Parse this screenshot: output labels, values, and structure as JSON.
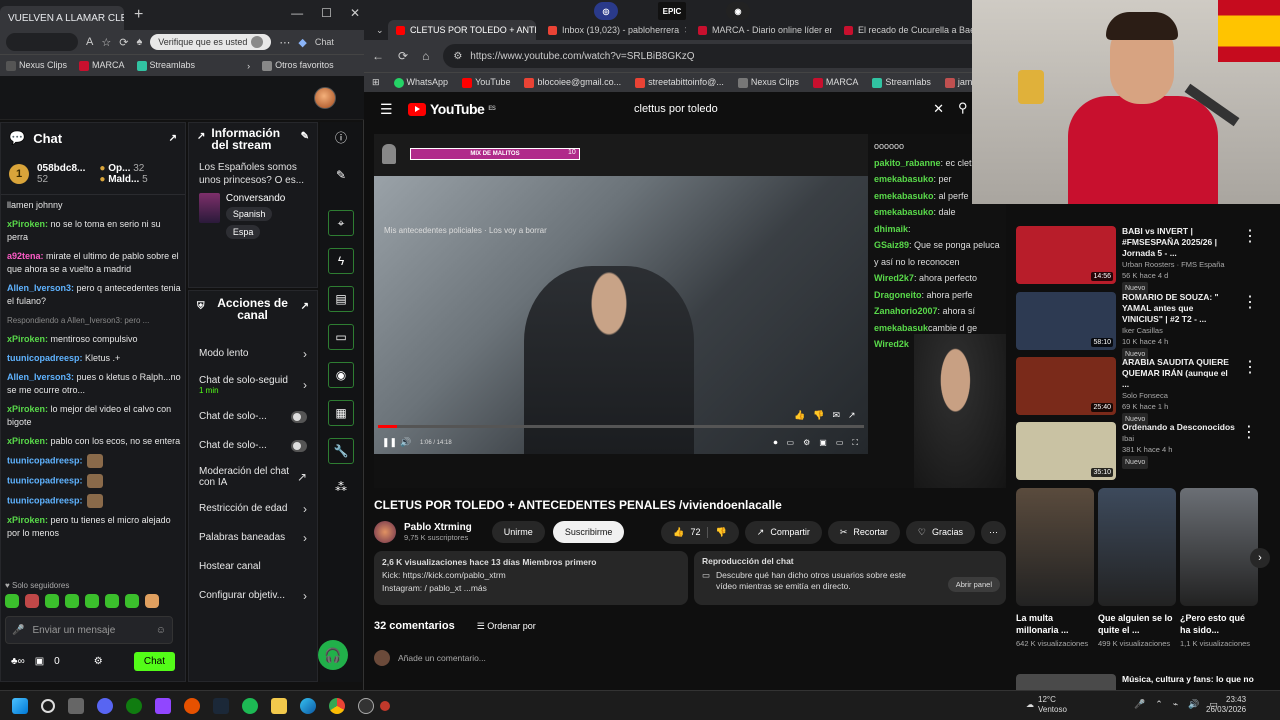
{
  "left_browser": {
    "tab_title": "VUELVEN A LLAMAR CLETUS A",
    "pill_text": "Verifique que es usted",
    "chat_label": "Chat",
    "bookmarks": [
      "Nexus Clips",
      "MARCA",
      "Streamlabs",
      "Otros favoritos"
    ]
  },
  "chat": {
    "title": "Chat",
    "leaders": [
      {
        "rank": "1",
        "name": "058bdc8...",
        "value": "52"
      },
      {
        "name": "Op...",
        "value": "32"
      },
      {
        "name": "Mald...",
        "value": "5"
      }
    ],
    "messages": [
      {
        "user": "",
        "text": "llamen johnny",
        "color": "#ffffff"
      },
      {
        "user": "xPiroken:",
        "text": "no se lo toma en serio ni su perra",
        "color": "#59d94a"
      },
      {
        "user": "a92tena:",
        "text": "mirate el ultimo de pablo sobre el que ahora se a vuelto a madrid",
        "color": "#ff5cc8"
      },
      {
        "user": "Allen_Iverson3:",
        "text": "pero q antecedentes tenia el fulano?",
        "color": "#5fb3ff"
      },
      {
        "reply": "Respondiendo a Allen_Iverson3: pero ..."
      },
      {
        "user": "xPiroken:",
        "text": "mentiroso compulsivo",
        "color": "#59d94a"
      },
      {
        "user": "tuunicopadreesp:",
        "text": "Kletus .+",
        "color": "#5fb3ff"
      },
      {
        "user": "Allen_Iverson3:",
        "text": "pues o kletus o Ralph...no se me ocurre otro...",
        "color": "#5fb3ff"
      },
      {
        "user": "xPiroken:",
        "text": "lo mejor del video el calvo con bigote",
        "color": "#59d94a"
      },
      {
        "user": "xPiroken:",
        "text": "pablo con los ecos, no se entera",
        "color": "#59d94a"
      },
      {
        "user": "tuunicopadreesp:",
        "text": "",
        "color": "#5fb3ff",
        "emote": true
      },
      {
        "user": "tuunicopadreesp:",
        "text": "",
        "color": "#5fb3ff",
        "emote": true
      },
      {
        "user": "tuunicopadreesp:",
        "text": "",
        "color": "#5fb3ff",
        "emote": true
      },
      {
        "user": "xPiroken:",
        "text": "pero tu tienes el micro alejado por lo menos",
        "color": "#59d94a"
      }
    ],
    "followers_only": "Solo seguidores",
    "input_placeholder": "Enviar un mensaje",
    "count": "0",
    "send": "Chat"
  },
  "stream_info": {
    "title": "Información del stream",
    "stream_title": "Los Españoles somos unos princesos? O es...",
    "category": "Conversando",
    "tags": [
      "Spanish",
      "Espa"
    ]
  },
  "actions": {
    "title": "Acciones de canal",
    "items": [
      {
        "label": "Modo lento",
        "kind": "chevron"
      },
      {
        "label": "Chat de solo-seguid",
        "sub": "1 min",
        "kind": "chevron"
      },
      {
        "label": "Chat de solo-...",
        "kind": "toggle"
      },
      {
        "label": "Chat de solo-...",
        "kind": "toggle"
      },
      {
        "label": "Moderación del chat con IA",
        "kind": "external"
      },
      {
        "label": "Restricción de edad",
        "kind": "chevron"
      },
      {
        "label": "Palabras baneadas",
        "kind": "chevron"
      },
      {
        "label": "Hostear canal",
        "kind": "none"
      },
      {
        "label": "Configurar objetiv...",
        "kind": "chevron"
      }
    ]
  },
  "yt_browser": {
    "tabs": [
      "CLETUS POR TOLEDO + ANTECE",
      "Inbox (19,023) - pabloherrera",
      "MARCA - Diario online líder en",
      "El recado de Cucurella a Baena"
    ],
    "top_icons": [
      "EPIC"
    ],
    "url": "https://www.youtube.com/watch?v=SRLBiB8GKzQ",
    "bookmarks": [
      "WhatsApp",
      "YouTube",
      "blocoiee@gmail.co...",
      "streetabittoinfo@...",
      "Nexus Clips",
      "MARCA",
      "Streamlabs",
      "jamonak"
    ],
    "search": "clettus por toledo",
    "logo_region": "ES"
  },
  "video": {
    "mix_bar": "MIX DE MALITOS",
    "mix_num": "10",
    "subtitle": "Mis antecedentes policiales · Los voy a borrar",
    "time": "1:06 / 14:18",
    "progress": 0.04,
    "stream_chat": [
      {
        "user": "",
        "text": "oooooo"
      },
      {
        "user": "pakito_rabanne",
        "text": ": ec cletus no?"
      },
      {
        "user": "emekabasuko",
        "text": ": per"
      },
      {
        "user": "emekabasuko",
        "text": ": al perfe"
      },
      {
        "user": "emekabasuko",
        "text": ": dale"
      },
      {
        "user": "dhimaik",
        "text": ":"
      },
      {
        "user": "GSaiz89",
        "text": ": Que se ponga peluca y así no lo reconocen"
      },
      {
        "user": "Wired2k7",
        "text": ": ahora perfecto"
      },
      {
        "user": "Dragoneito",
        "text": ": ahora perfe"
      },
      {
        "user": "Zanahorio2007",
        "text": ": ahora sí"
      },
      {
        "user": "emekabasuk",
        "text": "cambie d ge"
      },
      {
        "user": "Wired2k",
        "text": ""
      }
    ]
  },
  "meta": {
    "title": "CLETUS POR TOLEDO + ANTECEDENTES PENALES /viviendoenlacalle",
    "channel": "Pablo Xtrming",
    "subs": "9,75 K suscriptores",
    "unsubscribe": "Unirme",
    "subscribe": "Suscribirme",
    "likes": "72",
    "share": "Compartir",
    "clip": "Recortar",
    "thanks": "Gracias",
    "desc_line1": "2,6 K visualizaciones  hace 13 días  Miembros primero",
    "desc_line2": "Kick: https://kick.com/pablo_xtrm",
    "desc_line3": "Instagram: / pablo_xt  ...más",
    "replay_title": "Reproducción del chat",
    "replay_text": "Descubre qué han dicho otros usuarios sobre este vídeo mientras se emitía en directo.",
    "replay_btn": "Abrir panel",
    "comments": "32 comentarios",
    "sort": "Ordenar por",
    "add_comment": "Añade un comentario..."
  },
  "recommendations": [
    {
      "title": "BABI vs INVERT | #FMSESPAÑA 2025/26 | Jornada 5 - ...",
      "channel": "Urban Roosters · FMS España",
      "stats": "56 K  hace 4 d",
      "duration": "14:56",
      "color": "#b81d2a"
    },
    {
      "title": "ROMARIO DE SOUZA: \" YAMAL antes que VINICIUS\" | #2 T2 - ...",
      "channel": "Iker Casillas",
      "stats": "10 K  hace 4 h",
      "duration": "58:10",
      "color": "#2d3a52"
    },
    {
      "title": "ARABIA SAUDITA QUIERE QUEMAR IRÁN (aunque el ...",
      "channel": "Solo Fonseca",
      "stats": "69 K  hace 1 h",
      "duration": "25:40",
      "color": "#7a2a1a"
    },
    {
      "title": "Ordenando a Desconocidos",
      "channel": "Ibai",
      "stats": "381 K  hace 4 h",
      "duration": "35:10",
      "color": "#c9c2a3"
    }
  ],
  "shorts": [
    {
      "title": "La multa millonaria ...",
      "views": "642 K visualizaciones",
      "color": "#5a4b3d"
    },
    {
      "title": "Que alguien se lo quite el ...",
      "views": "499 K visualizaciones",
      "color": "#3d4a5c"
    },
    {
      "title": "¿Pero esto qué ha sido...",
      "views": "1,1 K visualizaciones",
      "color": "#6b6f75"
    }
  ],
  "next_rec": "Música, cultura y fans: lo que no",
  "taskbar": {
    "temp": "12°C",
    "weather": "Ventoso",
    "time": "23:43",
    "date": "26/03/2026"
  }
}
